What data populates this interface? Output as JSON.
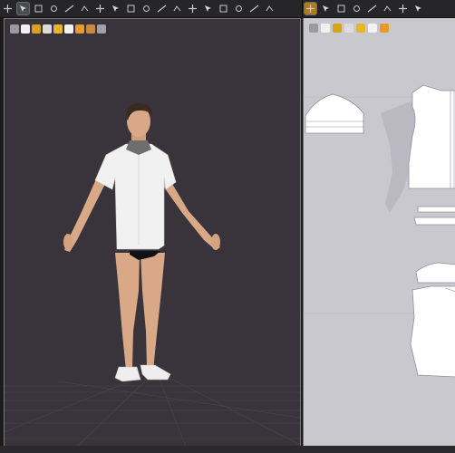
{
  "toolbar_left": {
    "buttons": [
      {
        "name": "move-icon",
        "active": false
      },
      {
        "name": "select-icon",
        "active": true
      },
      {
        "name": "transform-icon",
        "active": false
      },
      {
        "name": "pin-icon",
        "active": false
      },
      {
        "name": "tape-icon",
        "active": false
      },
      {
        "name": "sewing-icon",
        "active": false
      },
      {
        "name": "fold-icon",
        "active": false
      },
      {
        "name": "arrange-icon",
        "active": false
      },
      {
        "name": "point-icon",
        "active": false
      },
      {
        "name": "trim-icon",
        "active": false
      },
      {
        "name": "line-icon",
        "active": false
      },
      {
        "name": "seam-icon",
        "active": false
      },
      {
        "name": "button-icon",
        "active": false
      },
      {
        "name": "zipper-icon",
        "active": false
      },
      {
        "name": "measure-icon",
        "active": false
      },
      {
        "name": "texture-icon",
        "active": false
      },
      {
        "name": "pinning-icon",
        "active": false
      },
      {
        "name": "more-icon",
        "active": false
      }
    ]
  },
  "toolbar_right": {
    "buttons": [
      {
        "name": "edit-pattern-icon",
        "active": true
      },
      {
        "name": "transform-pattern-icon",
        "active": false
      },
      {
        "name": "polygon-icon",
        "active": false
      },
      {
        "name": "rectangle-icon",
        "active": false
      },
      {
        "name": "ellipse-icon",
        "active": false
      },
      {
        "name": "internal-line-icon",
        "active": false
      },
      {
        "name": "segment-sewing-icon",
        "active": false
      },
      {
        "name": "notch-icon",
        "active": false
      }
    ]
  },
  "viewport3d": {
    "tools": [
      "avatar-display-icon",
      "shirt-display-icon",
      "texture-display-icon",
      "figure-icon",
      "folder-icon",
      "camera-icon",
      "light-icon",
      "color-icon",
      "settings-icon"
    ],
    "colors": {
      "background": "#39343b",
      "shirt": "#f1f1f1",
      "skin": "#d9a987",
      "hair": "#3a2a22",
      "collar": "#6e6e6e",
      "underwear": "#111111",
      "shoe": "#eeeeee"
    }
  },
  "viewport2d": {
    "tools": [
      "pattern-select-icon",
      "copy-icon",
      "paint-icon",
      "texture-icon",
      "color-icon",
      "stitch-icon",
      "grade-icon"
    ],
    "colors": {
      "background": "#c9c8ce",
      "pattern": "#ffffff",
      "pattern_outline": "#8f8f9c"
    }
  }
}
